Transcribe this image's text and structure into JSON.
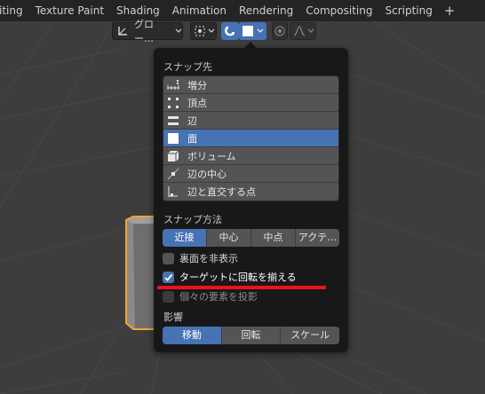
{
  "workspace_tabs": [
    "iting",
    "Texture Paint",
    "Shading",
    "Animation",
    "Rendering",
    "Compositing",
    "Scripting"
  ],
  "add_workspace_symbol": "+",
  "header": {
    "transform_orientation_label": "グロー…",
    "snap_toggle_active": true,
    "proportional_editing_active": false
  },
  "snap_popover": {
    "snap_to_title": "スナップ先",
    "snap_to_items": [
      {
        "label": "増分",
        "icon": "increment-icon",
        "selected": false
      },
      {
        "label": "頂点",
        "icon": "vertex-icon",
        "selected": false
      },
      {
        "label": "辺",
        "icon": "edge-icon",
        "selected": false
      },
      {
        "label": "面",
        "icon": "face-icon",
        "selected": true
      },
      {
        "label": "ボリューム",
        "icon": "volume-icon",
        "selected": false
      },
      {
        "label": "辺の中心",
        "icon": "edge-center-icon",
        "selected": false
      },
      {
        "label": "辺と直交する点",
        "icon": "edge-perpendicular-icon",
        "selected": false
      }
    ],
    "snap_with_title": "スナップ方法",
    "snap_with_options": [
      {
        "label": "近接",
        "selected": true
      },
      {
        "label": "中心",
        "selected": false
      },
      {
        "label": "中点",
        "selected": false
      },
      {
        "label": "アクテ…",
        "selected": false
      }
    ],
    "backface_culling": {
      "label": "裏面を非表示",
      "checked": false
    },
    "align_rotation": {
      "label": "ターゲットに回転を揃える",
      "checked": true
    },
    "project_individual": {
      "label": "個々の要素を投影",
      "checked": false
    },
    "affect_title": "影響",
    "affect_options": [
      {
        "label": "移動",
        "selected": true
      },
      {
        "label": "回転",
        "selected": false
      },
      {
        "label": "スケール",
        "selected": false
      }
    ]
  },
  "colors": {
    "accent": "#4772b3",
    "annotation": "#e8141e",
    "selection_outline": "#f5a331"
  }
}
